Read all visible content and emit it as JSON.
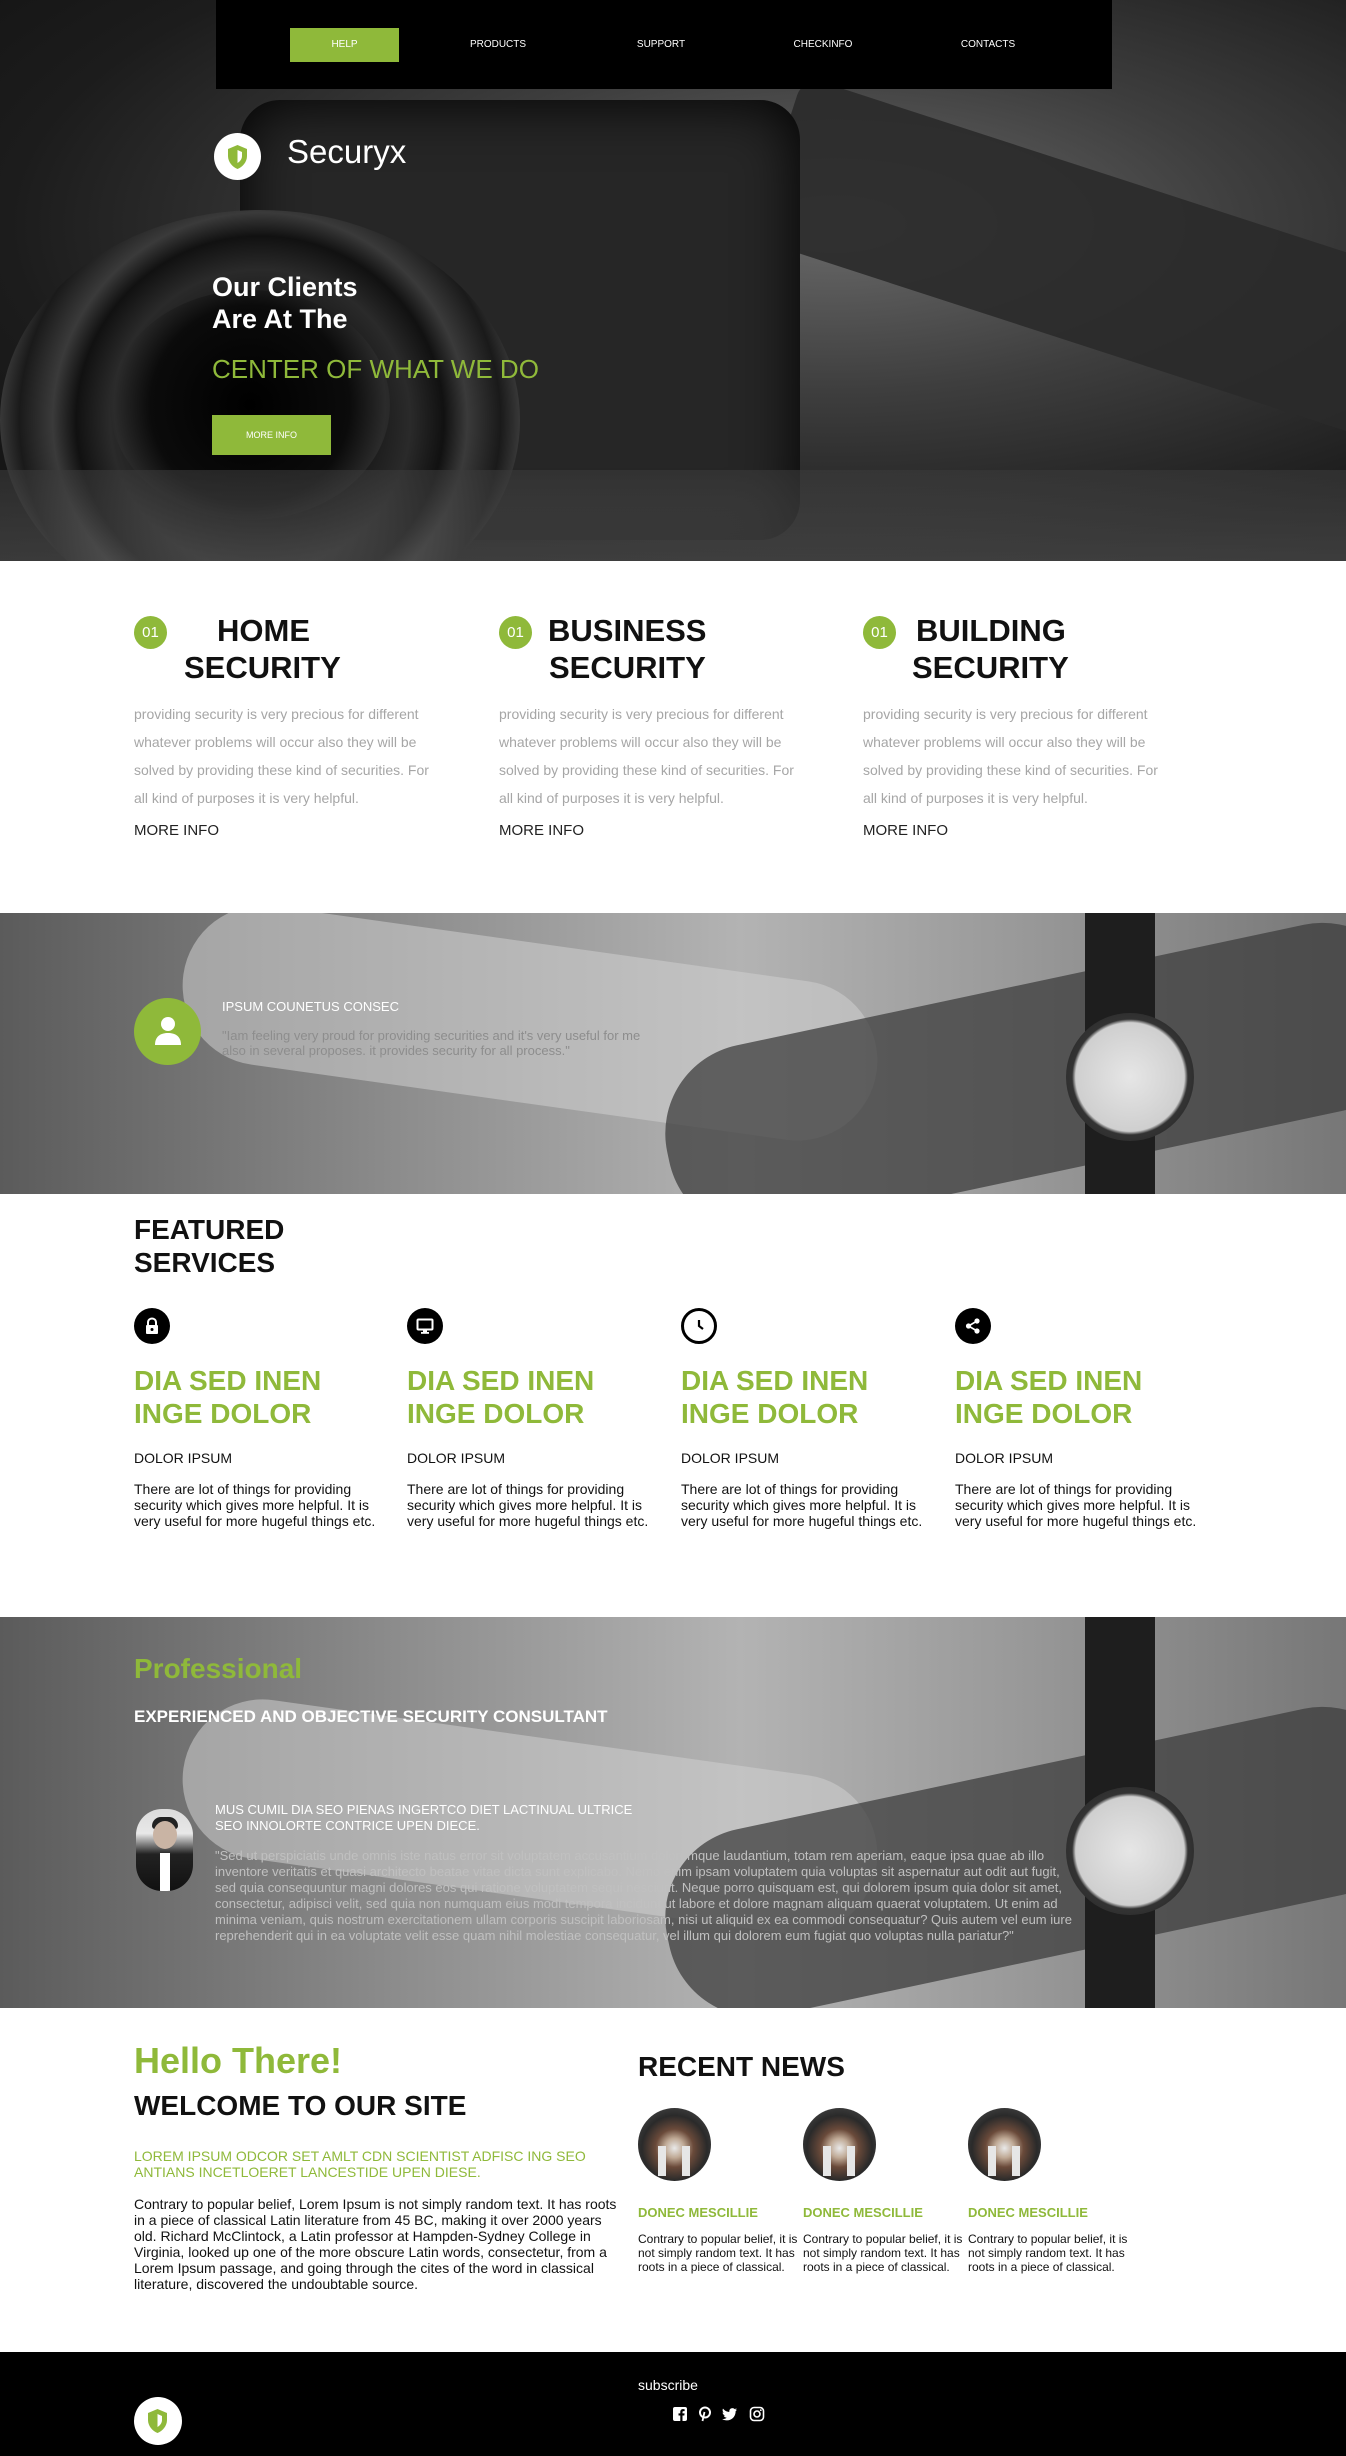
{
  "colors": {
    "accent": "#8fb93a",
    "dark": "#000000",
    "muted_text": "#a6a6a6"
  },
  "nav": {
    "items": [
      {
        "label": "HELP",
        "active": true
      },
      {
        "label": "PRODUCTS",
        "active": false
      },
      {
        "label": "SUPPORT",
        "active": false
      },
      {
        "label": "CHECKINFO",
        "active": false
      },
      {
        "label": "CONTACTS",
        "active": false
      }
    ]
  },
  "brand": {
    "name": "Securyx",
    "logo_icon": "shield-icon"
  },
  "hero": {
    "line1": "Our Clients",
    "line2": "Are At The",
    "highlight": "CENTER OF WHAT WE DO",
    "button": "MORE INFO"
  },
  "security": [
    {
      "num": "01",
      "title1": "HOME",
      "title2": "SECURITY",
      "text": "providing security is very precious for different whatever problems will occur also they will be solved by providing these kind of securities. For all kind of purposes it is very helpful.",
      "more": "MORE INFO"
    },
    {
      "num": "01",
      "title1": "BUSINESS",
      "title2": "SECURITY",
      "text": "providing security is very precious for different whatever problems will occur also they will be solved by providing these kind of securities. For all kind of purposes it is very helpful.",
      "more": "MORE INFO"
    },
    {
      "num": "01",
      "title1": "BUILDING",
      "title2": "SECURITY",
      "text": "providing security is very precious for different whatever problems will occur also they will be solved by providing these kind of securities. For all kind of purposes it is very helpful.",
      "more": "MORE INFO"
    }
  ],
  "quote": {
    "title": "IPSUM COUNETUS CONSEC",
    "text": "\"Iam feeling very proud for providing securities and it's very useful for me also in several proposes. it provides security for all process.\"",
    "icon": "user-icon"
  },
  "featured": {
    "title1": "FEATURED",
    "title2": "SERVICES",
    "items": [
      {
        "icon": "lock-icon",
        "h1": "DIA SED INEN",
        "h2": "INGE DOLOR",
        "sub": "DOLOR IPSUM",
        "text": "There are lot of things for providing security which gives more helpful. It is very useful for more hugeful things etc."
      },
      {
        "icon": "monitor-icon",
        "h1": "DIA SED INEN",
        "h2": "INGE DOLOR",
        "sub": "DOLOR IPSUM",
        "text": "There are lot of things for providing security which gives more helpful. It is very useful for more hugeful things etc."
      },
      {
        "icon": "clock-icon",
        "h1": "DIA SED INEN",
        "h2": "INGE DOLOR",
        "sub": "DOLOR IPSUM",
        "text": "There are lot of things for providing security which gives more helpful. It is very useful for more hugeful things etc."
      },
      {
        "icon": "share-icon",
        "h1": "DIA SED INEN",
        "h2": "INGE DOLOR",
        "sub": "DOLOR IPSUM",
        "text": "There are lot of things for providing security which gives more helpful. It is very useful for more hugeful things etc."
      }
    ]
  },
  "professional": {
    "title": "Professional",
    "subtitle": "EXPERIENCED AND OBJECTIVE SECURITY CONSULTANT",
    "testimonial_title": "MUS CUMIL DIA SEO PIENAS INGERTCO DIET LACTINUAL ULTRICE SEO INNOLORTE CONTRICE UPEN DIECE.",
    "testimonial_text": "\"Sed ut perspiciatis unde omnis iste natus error sit voluptatem accusantium doloremque laudantium, totam rem aperiam, eaque ipsa quae ab illo inventore veritatis et quasi architecto beatae vitae dicta sunt explicabo. Nemo enim ipsam voluptatem quia voluptas sit aspernatur aut odit aut fugit, sed quia consequuntur magni dolores eos qui ratione voluptatem sequi nesciunt. Neque porro quisquam est, qui dolorem ipsum quia dolor sit amet, consectetur, adipisci velit, sed quia non numquam eius modi tempora incidunt ut labore et dolore magnam aliquam quaerat voluptatem. Ut enim ad minima veniam, quis nostrum exercitationem ullam corporis suscipit laboriosam, nisi ut aliquid ex ea commodi consequatur? Quis autem vel eum iure reprehenderit qui in ea voluptate velit esse quam nihil molestiae consequatur, vel illum qui dolorem eum fugiat quo voluptas nulla pariatur?\""
  },
  "welcome": {
    "hello": "Hello There!",
    "title": "WELCOME TO OUR SITE",
    "green_text": "LOREM IPSUM ODCOR SET AMLT CDN SCIENTIST ADFISC ING SEO ANTIANS INCETLOERET LANCESTIDE UPEN DIESE.",
    "text": "Contrary to popular belief, Lorem Ipsum is not simply random text. It has roots in a piece of classical Latin literature from 45 BC, making it over 2000 years old. Richard McClintock, a Latin professor at Hampden-Sydney College in Virginia, looked up one of the more obscure Latin words, consectetur, from a Lorem Ipsum passage, and going through the cites of the word in classical literature, discovered the undoubtable source."
  },
  "news": {
    "title": "RECENT NEWS",
    "items": [
      {
        "heading": "DONEC MESCILLIE",
        "text": "Contrary to popular belief, it is not simply random text. It has roots in a piece of classical."
      },
      {
        "heading": "DONEC MESCILLIE",
        "text": "Contrary to popular belief, it is not simply random text. It has roots in a piece of classical."
      },
      {
        "heading": "DONEC MESCILLIE",
        "text": "Contrary to popular belief, it is not simply random text. It has roots in a piece of classical."
      }
    ]
  },
  "footer": {
    "subscribe": "subscribe",
    "social": [
      "facebook-icon",
      "pinterest-icon",
      "twitter-icon",
      "instagram-icon"
    ]
  }
}
